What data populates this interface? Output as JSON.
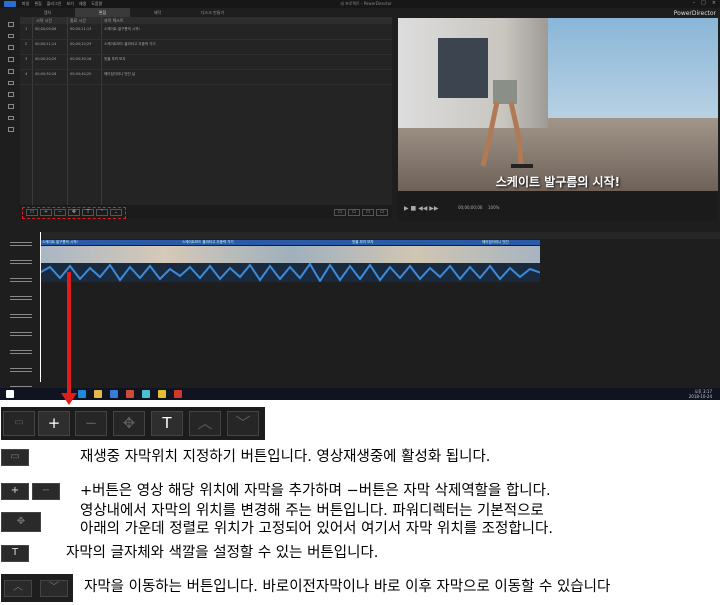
{
  "app": {
    "brand": "PowerDirector",
    "menu": [
      "파일",
      "편집",
      "플러그인",
      "보기",
      "재생",
      "도움말"
    ],
    "window_title": "새 프로젝트 - PowerDirector",
    "tabs": [
      "캡처",
      "편집",
      "제작",
      "디스크 만들기"
    ],
    "active_tab": 1
  },
  "subtitle_table": {
    "headers": [
      "시작 시간",
      "종료 시간",
      "자막 텍스트"
    ],
    "rows": [
      {
        "index": "1",
        "start": "00;00;00;06",
        "end": "00;00;11;13",
        "text": "스케이트 발구름의 시작!"
      },
      {
        "index": "2",
        "start": "00;00;11;14",
        "end": "00;00;20;29",
        "text": "스케이트보드 올라타고 무중력 가기"
      },
      {
        "index": "3",
        "start": "00;00;20;29",
        "end": "00;00;30;16",
        "text": "멋을 부려 보자"
      },
      {
        "index": "4",
        "start": "00;00;30;16",
        "end": "00;00;40;20",
        "text": "헤어짐이라니 멋진 날"
      }
    ]
  },
  "preview": {
    "caption": "스케이트 발구름의 시작!",
    "timecode": "00;00;00;06",
    "zoom": "100%"
  },
  "timeline": {
    "subtitle_clips": [
      "스케이트 발구름의 시작!",
      "스케이트보드 올라타고 무중력 가기",
      "멋을 부려 보자",
      "헤어짐이라니 멋진"
    ]
  },
  "taskbar": {
    "time": "오후 3:17",
    "date": "2018-10-24"
  },
  "toolbar_big": {
    "add": "+",
    "remove": "−",
    "text": "T",
    "icons": [
      "subtitle-position-icon",
      "plus-icon",
      "minus-icon",
      "move-icon",
      "text-icon",
      "chevron-up-icon",
      "chevron-down-icon"
    ]
  },
  "descriptions": {
    "position": "재생중 자막위치 지정하기 버튼입니다. 영상재생중에 활성화 됩니다.",
    "add_remove": "+버튼은 영상 해당 위치에 자막을 추가하며 −버튼은 자막 삭제역할을 합니다.",
    "move_line1": "영상내에서 자막의 위치를 변경해 주는 버튼입니다. 파워디렉터는 기본적으로",
    "move_line2": "아래의 가운데 정렬로 위치가 고정되어 있어서 여기서 자막 위치를 조정합니다.",
    "text": "자막의 글자체와 색깔을 설정할 수 있는 버튼입니다.",
    "navigate": "자막을 이동하는 버튼입니다. 바로이전자막이나 바로 이후 자막으로 이동할 수 있습니다"
  },
  "colors": {
    "highlight_red": "#e01c1c",
    "subtitle_blue": "#2b5aa8",
    "app_bg": "#1e1e1e"
  }
}
